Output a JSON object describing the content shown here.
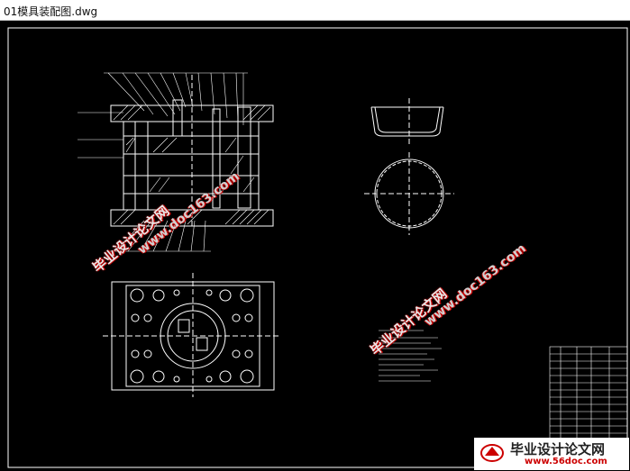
{
  "window": {
    "title": "01模具装配图.dwg"
  },
  "watermarks": {
    "cn_text": "毕业设计论文网",
    "url_text": "www.doc163.com"
  },
  "logo": {
    "text": "毕业设计论文网",
    "url": "www.56doc.com"
  },
  "colors": {
    "drawing_background": "#000000",
    "line": "#ffffff",
    "watermark_accent": "#cc0000"
  }
}
